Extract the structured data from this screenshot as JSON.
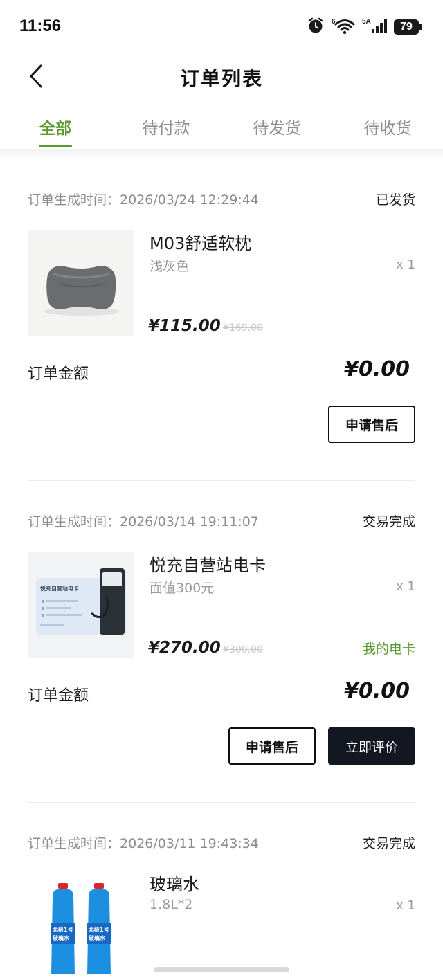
{
  "status_bar": {
    "time": "11:56",
    "icons": [
      "alarm-icon",
      "wifi-6-icon",
      "signal-5a-icon",
      "battery-icon"
    ],
    "battery": "79"
  },
  "header": {
    "title": "订单列表",
    "back_icon": "chevron-left-icon"
  },
  "tabs": [
    {
      "label": "全部",
      "active": true
    },
    {
      "label": "待付款",
      "active": false
    },
    {
      "label": "待发货",
      "active": false
    },
    {
      "label": "待收货",
      "active": false
    }
  ],
  "colors": {
    "accent": "#5a9a2e",
    "dark_button": "#121722",
    "muted_text": "#8c8c8c"
  },
  "orders": [
    {
      "time_label": "订单生成时间：",
      "time": "2026/03/24 12:29:44",
      "status": "已发货",
      "product": {
        "name": "M03舒适软枕",
        "spec": "浅灰色",
        "qty": "x 1",
        "price": "¥115.00",
        "original_price": "¥169.00",
        "image": "pillow-image"
      },
      "amount_label": "订单金额",
      "amount": "¥0.00",
      "buttons": [
        "申请售后"
      ]
    },
    {
      "time_label": "订单生成时间：",
      "time": "2026/03/14 19:11:07",
      "status": "交易完成",
      "product": {
        "name": "悦充自营站电卡",
        "spec": "面值300元",
        "qty": "x 1",
        "price": "¥270.00",
        "original_price": "¥300.00",
        "link": "我的电卡",
        "image": "charging-card-image",
        "card_title": "悦充自营站电卡"
      },
      "amount_label": "订单金额",
      "amount": "¥0.00",
      "buttons": [
        "申请售后",
        "立即评价"
      ]
    },
    {
      "time_label": "订单生成时间：",
      "time": "2026/03/11 19:43:34",
      "status": "交易完成",
      "product": {
        "name": "玻璃水",
        "spec": "1.8L*2",
        "qty": "x 1",
        "image": "washer-fluid-image"
      }
    }
  ]
}
